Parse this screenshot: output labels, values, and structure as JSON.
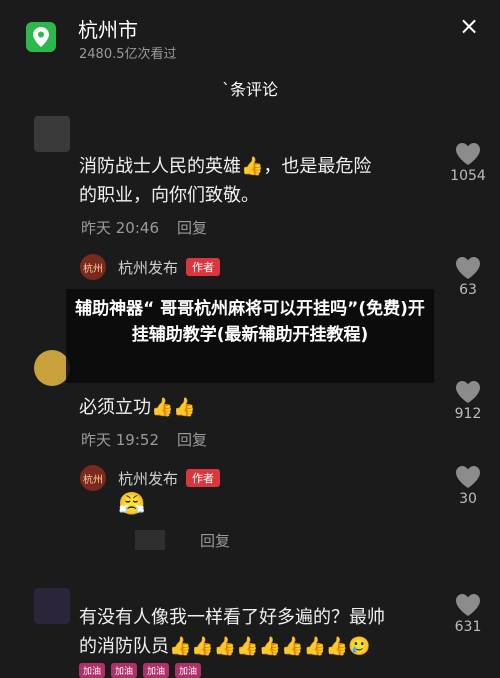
{
  "header": {
    "title": "杭州市",
    "views": "2480.5亿次看过",
    "close": "×"
  },
  "comments_header": "`条评论",
  "overlay": {
    "text": "辅助神器“ 哥哥杭州麻将可以开挂吗”(免费)开挂辅助教学(最新辅助开挂教程)"
  },
  "comments": [
    {
      "text_line1": "消防战士人民的英雄👍，也是最危险",
      "text_line2": "的职业，向你们致敬。",
      "time": "昨天 20:46",
      "reply": "回复",
      "likes": "1054"
    },
    {
      "author": "杭州发布",
      "badge": "作者",
      "likes": "63"
    },
    {
      "text": "必须立功👍👍",
      "time": "昨天 19:52",
      "reply": "回复",
      "likes": "912"
    },
    {
      "author": "杭州发布",
      "badge": "作者",
      "emoji": "😤",
      "reply": "回复",
      "likes": "30"
    },
    {
      "text_line1": "有没有人像我一样看了好多遍的？最帅",
      "text_line2": "的消防队员👍👍👍👍👍👍👍👍🥲",
      "likes": "631"
    }
  ],
  "avatars": {
    "hangzhou": "杭州"
  },
  "tags": [
    "加油",
    "加油",
    "加油",
    "加油"
  ]
}
